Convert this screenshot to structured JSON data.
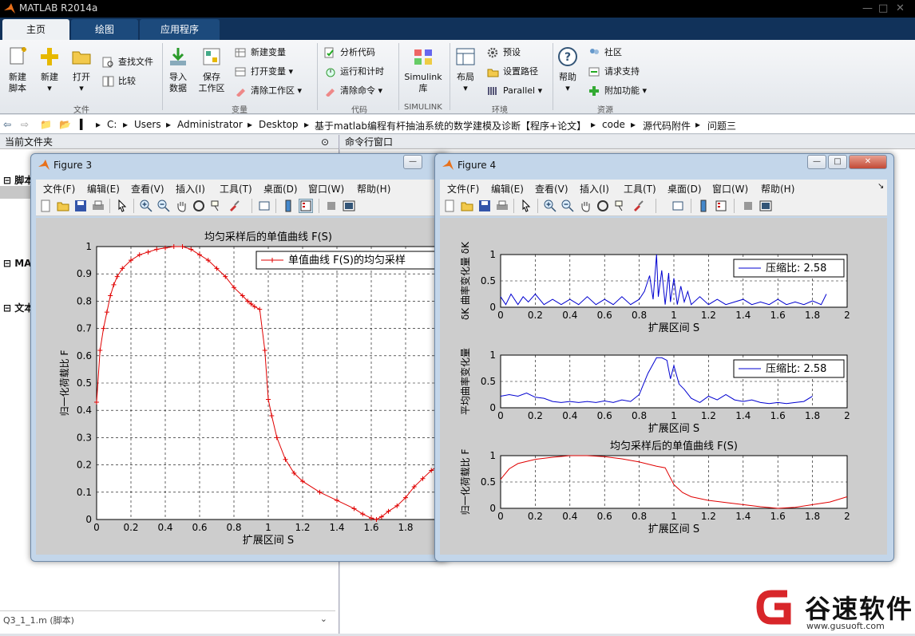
{
  "app": {
    "title": "MATLAB R2014a"
  },
  "tabs": [
    "主页",
    "绘图",
    "应用程序"
  ],
  "ribbon": {
    "new_script": "新建\n脚本",
    "new": "新建",
    "open": "打开",
    "find_files": "查找文件",
    "compare": "比较",
    "import": "导入\n数据",
    "save_ws": "保存\n工作区",
    "new_var": "新建变量",
    "open_var": "打开变量",
    "clear_ws": "清除工作区",
    "analyze": "分析代码",
    "run_time": "运行和计时",
    "clear_cmd": "清除命令",
    "simulink": "Simulink\n库",
    "layout": "布局",
    "prefs": "预设",
    "set_path": "设置路径",
    "parallel": "Parallel",
    "help": "帮助",
    "community": "社区",
    "support": "请求支持",
    "addons": "附加功能",
    "groups": {
      "file": "文件",
      "var": "变量",
      "code": "代码",
      "simulink": "SIMULINK",
      "env": "环境",
      "res": "资源"
    }
  },
  "path": [
    "C:",
    "Users",
    "Administrator",
    "Desktop",
    "基于matlab编程有杆抽油系统的数学建模及诊断【程序+论文】",
    "code",
    "源代码附件",
    "问题三"
  ],
  "left_panel": {
    "title": "当前文件夹",
    "items": [
      "脚本",
      "MA",
      "文本"
    ],
    "footer": "Q3_1_1.m (脚本)"
  },
  "command_window": {
    "title": "命令行窗口"
  },
  "menus": [
    "文件(F)",
    "编辑(E)",
    "查看(V)",
    "插入(I)",
    "工具(T)",
    "桌面(D)",
    "窗口(W)",
    "帮助(H)"
  ],
  "fig3": {
    "title": "Figure 3"
  },
  "fig4": {
    "title": "Figure 4"
  },
  "chart_data": [
    {
      "type": "line",
      "title": "均匀采样后的单值曲线 F(S)",
      "xlabel": "扩展区间 S",
      "ylabel": "归一化荷载比 F",
      "legend": "单值曲线 F(S)的均匀采样",
      "xlim": [
        0,
        2
      ],
      "ylim": [
        0,
        1
      ],
      "grid": true,
      "color": "#e00000",
      "marker": "+",
      "x": [
        0,
        0.02,
        0.04,
        0.06,
        0.08,
        0.1,
        0.12,
        0.15,
        0.2,
        0.25,
        0.3,
        0.35,
        0.4,
        0.45,
        0.5,
        0.55,
        0.6,
        0.65,
        0.7,
        0.75,
        0.8,
        0.85,
        0.88,
        0.9,
        0.92,
        0.95,
        0.98,
        1.0,
        1.02,
        1.05,
        1.1,
        1.15,
        1.2,
        1.3,
        1.4,
        1.5,
        1.55,
        1.6,
        1.63,
        1.66,
        1.7,
        1.75,
        1.8,
        1.85,
        1.9,
        1.95,
        2.0
      ],
      "y": [
        0.43,
        0.62,
        0.7,
        0.76,
        0.82,
        0.86,
        0.89,
        0.92,
        0.95,
        0.97,
        0.98,
        0.99,
        0.995,
        1.0,
        1.0,
        0.99,
        0.97,
        0.95,
        0.92,
        0.89,
        0.85,
        0.82,
        0.8,
        0.79,
        0.78,
        0.77,
        0.62,
        0.44,
        0.38,
        0.3,
        0.22,
        0.17,
        0.14,
        0.1,
        0.07,
        0.04,
        0.02,
        0.005,
        0.0,
        0.01,
        0.03,
        0.05,
        0.08,
        0.12,
        0.15,
        0.18,
        0.2
      ]
    },
    {
      "type": "line",
      "ylabel": "δK 曲率变化量 δK",
      "xlabel": "扩展区间 S",
      "legend": "压缩比: 2.58",
      "xlim": [
        0,
        2
      ],
      "ylim": [
        0,
        1
      ],
      "grid": true,
      "color": "#0000d0",
      "x": [
        0,
        0.03,
        0.06,
        0.1,
        0.13,
        0.16,
        0.2,
        0.25,
        0.3,
        0.35,
        0.4,
        0.45,
        0.5,
        0.55,
        0.6,
        0.65,
        0.7,
        0.75,
        0.8,
        0.83,
        0.86,
        0.88,
        0.9,
        0.91,
        0.93,
        0.95,
        0.97,
        0.98,
        1.0,
        1.02,
        1.04,
        1.06,
        1.08,
        1.1,
        1.15,
        1.2,
        1.25,
        1.3,
        1.35,
        1.4,
        1.45,
        1.5,
        1.55,
        1.6,
        1.65,
        1.7,
        1.75,
        1.8,
        1.85,
        1.88
      ],
      "y": [
        0.2,
        0.05,
        0.25,
        0.05,
        0.2,
        0.1,
        0.25,
        0.05,
        0.15,
        0.05,
        0.15,
        0.05,
        0.2,
        0.05,
        0.15,
        0.05,
        0.2,
        0.05,
        0.15,
        0.3,
        0.6,
        0.15,
        1.0,
        0.2,
        0.7,
        0.05,
        0.65,
        0.1,
        0.55,
        0.05,
        0.4,
        0.1,
        0.3,
        0.05,
        0.2,
        0.05,
        0.15,
        0.05,
        0.1,
        0.15,
        0.05,
        0.1,
        0.05,
        0.15,
        0.05,
        0.1,
        0.05,
        0.12,
        0.05,
        0.25
      ]
    },
    {
      "type": "line",
      "ylabel": "平均曲率变化量",
      "xlabel": "扩展区间 S",
      "legend": "压缩比: 2.58",
      "xlim": [
        0,
        2
      ],
      "ylim": [
        0,
        1
      ],
      "grid": true,
      "color": "#0000d0",
      "x": [
        0,
        0.05,
        0.1,
        0.15,
        0.2,
        0.25,
        0.3,
        0.35,
        0.4,
        0.45,
        0.5,
        0.55,
        0.6,
        0.65,
        0.7,
        0.75,
        0.8,
        0.85,
        0.9,
        0.93,
        0.96,
        0.98,
        1.0,
        1.03,
        1.06,
        1.1,
        1.15,
        1.2,
        1.25,
        1.3,
        1.35,
        1.4,
        1.45,
        1.5,
        1.55,
        1.6,
        1.65,
        1.7,
        1.75,
        1.8
      ],
      "y": [
        0.22,
        0.25,
        0.22,
        0.28,
        0.2,
        0.18,
        0.12,
        0.1,
        0.12,
        0.1,
        0.12,
        0.1,
        0.13,
        0.1,
        0.15,
        0.12,
        0.25,
        0.65,
        0.95,
        0.95,
        0.9,
        0.55,
        0.8,
        0.45,
        0.35,
        0.18,
        0.1,
        0.22,
        0.15,
        0.25,
        0.15,
        0.12,
        0.15,
        0.1,
        0.08,
        0.1,
        0.08,
        0.1,
        0.12,
        0.22
      ]
    },
    {
      "type": "line",
      "title": "均匀采样后的单值曲线 F(S)",
      "xlabel": "扩展区间 S",
      "ylabel": "归一化荷载比 F",
      "xlim": [
        0,
        2
      ],
      "ylim": [
        0,
        1
      ],
      "grid": true,
      "color": "#e00000",
      "x": [
        0,
        0.05,
        0.1,
        0.2,
        0.3,
        0.4,
        0.5,
        0.6,
        0.7,
        0.8,
        0.9,
        0.95,
        1.0,
        1.05,
        1.1,
        1.2,
        1.3,
        1.4,
        1.5,
        1.6,
        1.7,
        1.8,
        1.9,
        2.0
      ],
      "y": [
        0.55,
        0.75,
        0.85,
        0.93,
        0.97,
        1.0,
        1.0,
        0.98,
        0.94,
        0.88,
        0.8,
        0.77,
        0.45,
        0.3,
        0.22,
        0.15,
        0.11,
        0.07,
        0.03,
        0.0,
        0.02,
        0.07,
        0.12,
        0.22
      ]
    }
  ],
  "watermark": {
    "text": "谷速软件",
    "url": "www.gusuoft.com"
  }
}
